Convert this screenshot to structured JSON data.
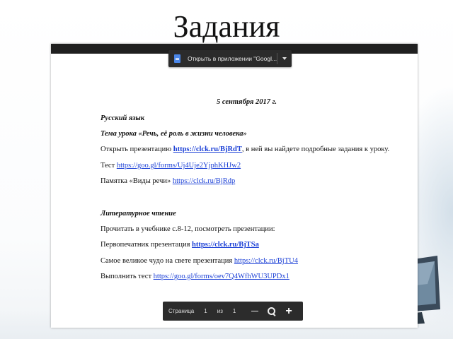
{
  "slide": {
    "title": "Задания"
  },
  "viewer": {
    "open_in_app_label": "Открыть в приложении \"Googl...",
    "document": {
      "date": "5 сентября 2017 г.",
      "russian": {
        "heading": "Русский язык",
        "topic": "Тема урока «Речь, её роль в жизни человека»",
        "presentation_text": "Открыть презентацию",
        "presentation_link": "https://clck.ru/BjRdT",
        "presentation_suffix": ", в ней вы найдете подробные задания к уроку.",
        "test_text": "Тест",
        "test_link": "https://goo.gl/forms/Uj4Uje2YjphKHJw2",
        "memo_text": "Памятка «Виды речи»",
        "memo_link": "https://clck.ru/BjRdp"
      },
      "literature": {
        "heading": "Литературное чтение",
        "read_text": "Прочитать в учебнике с.8-12, посмотреть презентации:",
        "first_text": "Первопечатник презентация",
        "first_link": "https://clck.ru/BjTSa",
        "wonder_text": "Самое великое чудо на свете презентация",
        "wonder_link": "https://clck.ru/BjTU4",
        "test_text": "Выполнить тест",
        "test_link": "https://goo.gl/forms/oev7Q4WfhWU3UPDx1"
      }
    },
    "page_bar": {
      "page_label": "Страница",
      "page_number": "1",
      "of_label": "из",
      "page_total": "1"
    }
  }
}
